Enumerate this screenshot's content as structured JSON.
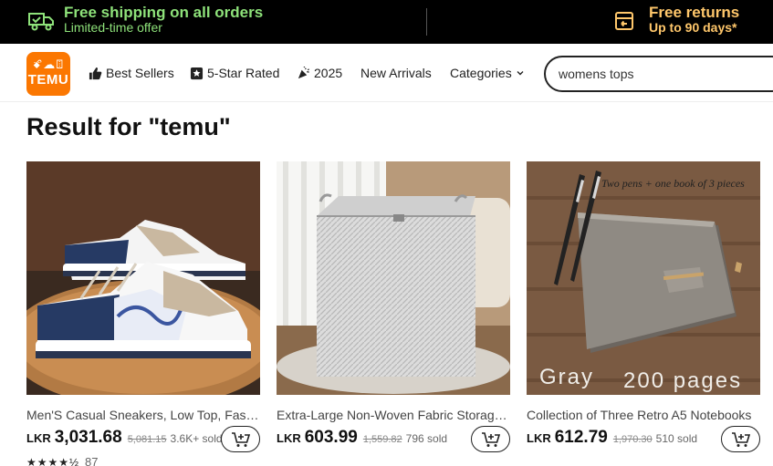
{
  "promo": {
    "shipping_title": "Free shipping on all orders",
    "shipping_sub": "Limited-time offer",
    "returns_title": "Free returns",
    "returns_sub": "Up to 90 days*",
    "colors": {
      "green": "#8ee27a",
      "gold": "#ffc76b",
      "bar_bg": "#000000"
    }
  },
  "nav": {
    "logo_top": "ꗄ☁ꘖ",
    "logo_text": "TEMU",
    "logo_color": "#fb7701",
    "items": [
      {
        "label": "Best Sellers",
        "icon": "thumbs-up-icon"
      },
      {
        "label": "5-Star Rated",
        "icon": "star-badge-icon"
      },
      {
        "label": "2025",
        "icon": "party-popper-icon"
      },
      {
        "label": "New Arrivals",
        "icon": ""
      },
      {
        "label": "Categories",
        "icon": "chevron-down-icon"
      }
    ],
    "search_value": "womens tops"
  },
  "result_title": "Result for \"temu\"",
  "products": [
    {
      "title": "Men'S Casual Sneakers, Low Top, Fashion Sneakers",
      "currency": "LKR",
      "price": "3,031.68",
      "old_price": "5,081.15",
      "sold": "3.6K+ sold",
      "stars": "★★★★½",
      "rating_count": "87"
    },
    {
      "title": "Extra-Large Non-Woven Fabric Storage Bag",
      "currency": "LKR",
      "price": "603.99",
      "old_price": "1,559.82",
      "sold": "796 sold"
    },
    {
      "title": "Collection of Three Retro A5 Notebooks",
      "currency": "LKR",
      "price": "612.79",
      "old_price": "1,970.30",
      "sold": "510 sold",
      "image_text_top": "Two pens + one book of 3 pieces",
      "image_text_left": "Gray",
      "image_text_right": "200 pages"
    }
  ]
}
